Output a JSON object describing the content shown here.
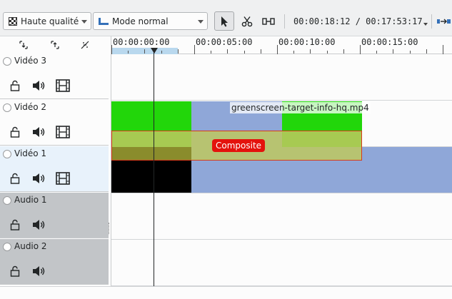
{
  "toolbar": {
    "quality_select": {
      "value": "Haute qualité",
      "icon": "checkerboard-icon"
    },
    "mode_select": {
      "value": "Mode normal",
      "icon": "timeline-mode-icon"
    },
    "tools": [
      "selection-tool",
      "razor-tool",
      "spacer-tool"
    ],
    "timecode": "00:00:18:12 / 00:17:53:17"
  },
  "ruler": {
    "labels": [
      "00:00:00:00",
      "00:00:05:00",
      "00:00:10:00",
      "00:00:15:00"
    ]
  },
  "tracks": [
    {
      "name": "Vidéo 3",
      "kind": "video"
    },
    {
      "name": "Vidéo 2",
      "kind": "video"
    },
    {
      "name": "Vidéo 1",
      "kind": "video",
      "selected": true
    },
    {
      "name": "Audio 1",
      "kind": "audio"
    },
    {
      "name": "Audio 2",
      "kind": "audio"
    }
  ],
  "clips": {
    "upper_clip_name": "greenscreen-target-info-hq.mp4",
    "composite_label": "Composite"
  },
  "colors": {
    "accent": "#3daee9",
    "clip_blue": "#8fa7d8",
    "clip_green": "#22d60a",
    "composite_red": "#e4120c",
    "audio_track_bg": "#c2c5c8"
  }
}
